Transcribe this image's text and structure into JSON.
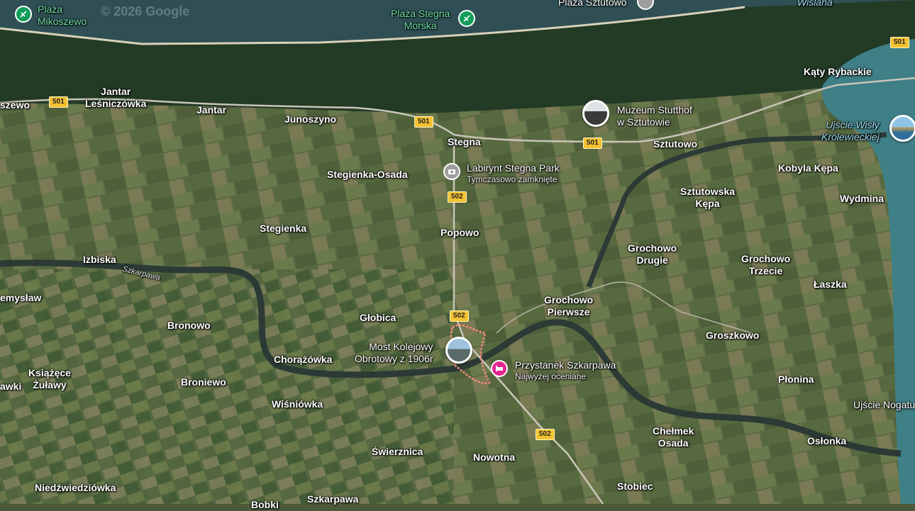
{
  "copyright": "© 2026 Google",
  "shields": [
    {
      "id": "501-a",
      "text": "501"
    },
    {
      "id": "501-b",
      "text": "501"
    },
    {
      "id": "501-c",
      "text": "501"
    },
    {
      "id": "501-d",
      "text": "501"
    },
    {
      "id": "502-a",
      "text": "502"
    },
    {
      "id": "502-b",
      "text": "502"
    },
    {
      "id": "502-c",
      "text": "502"
    }
  ],
  "places": {
    "plaza_mikoszewo": {
      "line1": "Plaża",
      "line2": "Mikoszewo"
    },
    "plaza_stegna": {
      "line1": "Plaża Stegna",
      "line2": "Morska"
    },
    "plaza_sztutowo": "Plaża Sztutowo",
    "wislana": "Wiślana",
    "jantar_lesniczowka": {
      "line1": "Jantar",
      "line2": "Leśniczówka"
    },
    "mikoszewo_edge": "szewo",
    "jantar": "Jantar",
    "junoszyno": "Junoszyno",
    "stegna": "Stegna",
    "muzeum": {
      "line1": "Muzeum Stutthof",
      "line2": "w Sztutowie"
    },
    "katy_rybackie": "Kąty Rybackie",
    "ujscie_wisly": {
      "line1": "Ujście Wisły",
      "line2": "Królewieckiej"
    },
    "sztutowo": "Sztutowo",
    "labirynt": {
      "name": "Labirynt Stegna Park",
      "sub": "Tymczasowo zamknięte"
    },
    "stegienka_osada": "Stegienka-Osada",
    "kobyla_kepa": "Kobyla Kępa",
    "sztutowska_kepa": {
      "line1": "Sztutowska",
      "line2": "Kępa"
    },
    "wydmina": "Wydmina",
    "stegienka": "Stegienka",
    "popowo": "Popowo",
    "grochowo_drugie": {
      "line1": "Grochowo",
      "line2": "Drugie"
    },
    "grochowo_trzecie": {
      "line1": "Grochowo",
      "line2": "Trzecie"
    },
    "izbiska": "Izbiska",
    "szkarpawa_river": "Szkarpawa",
    "przemyslaw": "emysław",
    "laszka": "Łaszka",
    "grochowo_pierwsze": {
      "line1": "Grochowo",
      "line2": "Pierwsze"
    },
    "globica": "Głobica",
    "bronowo": "Bronowo",
    "groszkowo": "Groszkowo",
    "most": {
      "line1": "Most Kolejowy",
      "line2": "Obrotowy z 1906r"
    },
    "chorazowka": "Chorążówka",
    "przystanek": {
      "name": "Przystanek Szkarpawa",
      "sub": "Najwyżej oceniane"
    },
    "ksiazece_zulawy": {
      "line1": "Książęce",
      "line2": "Żuławy"
    },
    "zawki": "awki",
    "broniewo": "Broniewo",
    "plonina": "Płonina",
    "ujscie_nogatu": "Ujście Nogatu",
    "wisniowka": "Wiśniówka",
    "chelmek_osada": {
      "line1": "Chełmek",
      "line2": "Osada"
    },
    "swierznica": "Świerznica",
    "nowotna": "Nowotna",
    "oslonka": "Osłonka",
    "niedzwiedziowka": "Niedźwiedziówka",
    "szkarpawa_village": "Szkarpawa",
    "stobiec": "Stobiec",
    "bobki": "Bobki"
  },
  "colors": {
    "sea": "#2f4f55",
    "lagoon": "#3f7f86",
    "river": "#2b3a35",
    "road": "#c9c5b8",
    "shield": "#f3c232",
    "poi_green": "#0f9d58",
    "poi_pink": "#e52592",
    "highlight": "#ff8a80"
  },
  "icons": [
    "beach-icon",
    "museum-icon",
    "camera-icon",
    "hotel-icon",
    "location-pin-icon"
  ]
}
